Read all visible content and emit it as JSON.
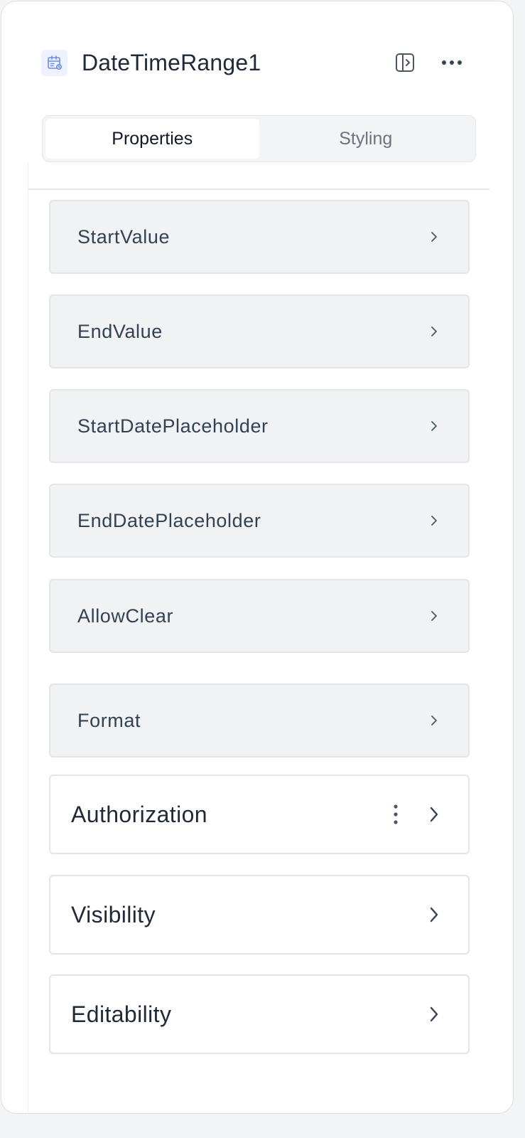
{
  "header": {
    "title": "DateTimeRange1",
    "component_icon": "calendar-icon",
    "toggle_icon": "panel-toggle-icon",
    "more_icon": "more-horizontal-icon"
  },
  "tabs": [
    {
      "label": "Properties",
      "active": true
    },
    {
      "label": "Styling",
      "active": false
    }
  ],
  "properties": [
    {
      "label": "StartValue"
    },
    {
      "label": "EndValue"
    },
    {
      "label": "StartDatePlaceholder"
    },
    {
      "label": "EndDatePlaceholder"
    },
    {
      "label": "AllowClear"
    },
    {
      "label": "Format"
    }
  ],
  "sections": [
    {
      "label": "Authorization",
      "has_menu": true
    },
    {
      "label": "Visibility",
      "has_menu": false
    },
    {
      "label": "Editability",
      "has_menu": false
    }
  ],
  "colors": {
    "icon_accent": "#6b8cef",
    "text_primary": "#1f2937",
    "text_muted": "#6b7280",
    "row_bg": "#f1f2f4"
  }
}
